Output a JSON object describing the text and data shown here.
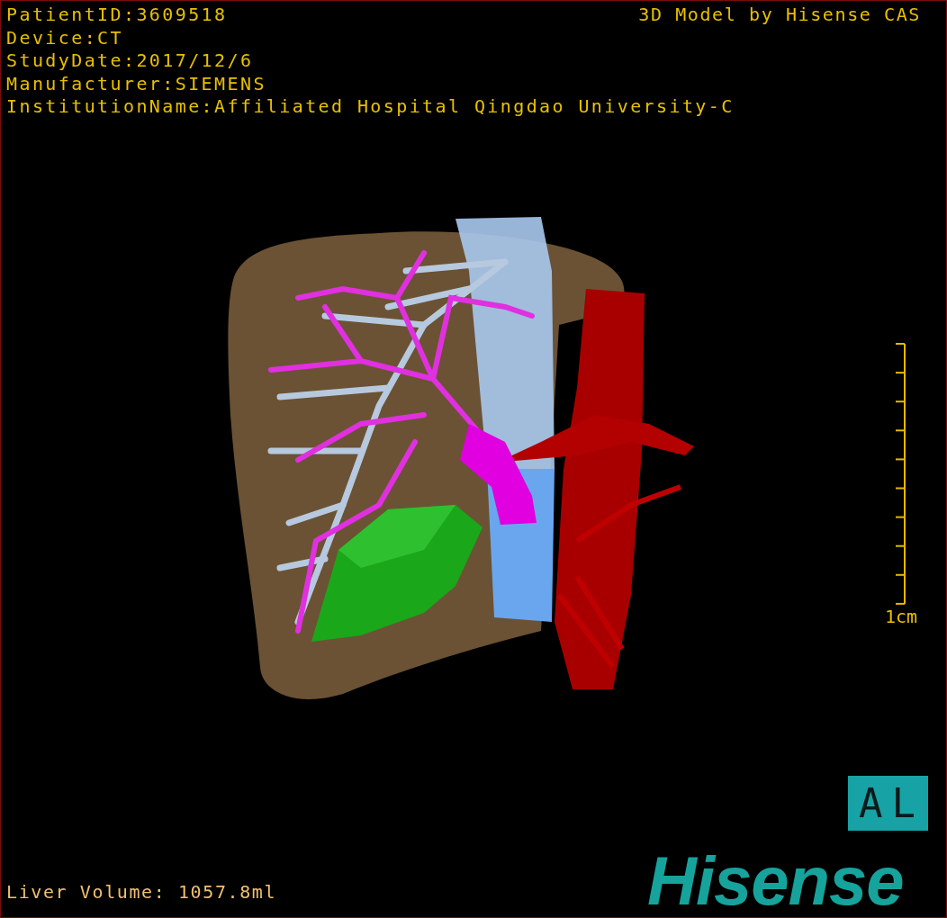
{
  "study_info": [
    "PatientID:3609518",
    "Device:CT",
    "StudyDate:2017/12/6",
    "Manufacturer:SIEMENS",
    "InstitutionName:Affiliated Hospital Qingdao University-C"
  ],
  "model_credit": "3D Model by Hisense CAS",
  "scale_bar": {
    "label": "1cm"
  },
  "orientation_label": "AL",
  "liver_volume": "Liver Volume: 1057.8ml",
  "logo": "Hisense"
}
